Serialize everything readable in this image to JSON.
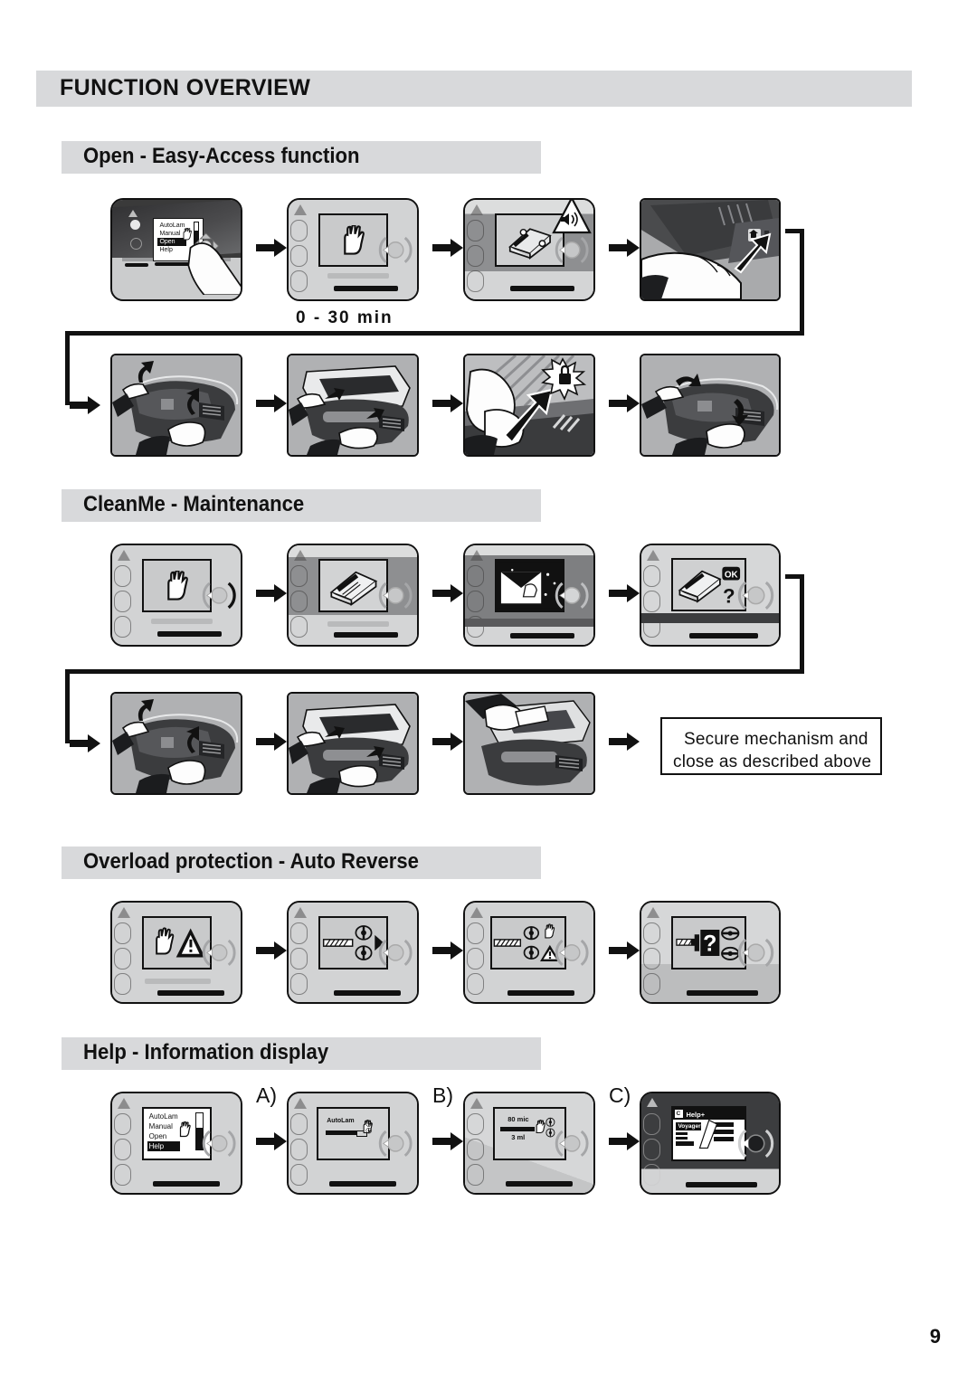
{
  "page": {
    "title": "FUNCTION OVERVIEW",
    "number": "9"
  },
  "sections": [
    {
      "id": "open-easy-access",
      "heading": "Open - Easy-Access function",
      "rows": [
        {
          "steps": [
            {
              "name": "console-menu-select",
              "kind": "device-photo"
            },
            {
              "name": "display-hand-wait",
              "kind": "device-lcd",
              "caption": "0 - 30 min"
            },
            {
              "name": "display-cartridge-beep",
              "kind": "device-lcd"
            },
            {
              "name": "photo-pull-lever",
              "kind": "photo"
            }
          ]
        },
        {
          "steps": [
            {
              "name": "photo-open-lid",
              "kind": "photo"
            },
            {
              "name": "photo-press-rollers",
              "kind": "photo"
            },
            {
              "name": "photo-lock-latch",
              "kind": "photo"
            },
            {
              "name": "photo-close-lid",
              "kind": "photo"
            }
          ]
        }
      ]
    },
    {
      "id": "cleanme-maintenance",
      "heading": "CleanMe - Maintenance",
      "rows": [
        {
          "steps": [
            {
              "name": "display-hand-wait",
              "kind": "device-lcd"
            },
            {
              "name": "display-cleaning-card",
              "kind": "device-lcd"
            },
            {
              "name": "display-insert-sheet",
              "kind": "device-lcd"
            },
            {
              "name": "display-cleaning-ok-question",
              "kind": "device-lcd"
            }
          ]
        },
        {
          "steps": [
            {
              "name": "photo-open-lid",
              "kind": "photo"
            },
            {
              "name": "photo-press-rollers",
              "kind": "photo"
            },
            {
              "name": "photo-wipe-rollers",
              "kind": "photo"
            }
          ],
          "note": {
            "name": "secure-mechanism-note",
            "lines": [
              "Secure mechanism and",
              "close as described above"
            ]
          }
        }
      ]
    },
    {
      "id": "overload-protection",
      "heading": "Overload protection - Auto Reverse",
      "rows": [
        {
          "steps": [
            {
              "name": "display-hand-warning",
              "kind": "device-lcd"
            },
            {
              "name": "display-rollers-forward",
              "kind": "device-lcd"
            },
            {
              "name": "display-rollers-stop-warning",
              "kind": "device-lcd"
            },
            {
              "name": "display-eject-question",
              "kind": "device-lcd"
            }
          ]
        }
      ]
    },
    {
      "id": "help-information-display",
      "heading": "Help - Information display",
      "rows": [
        {
          "steps": [
            {
              "name": "display-main-menu",
              "kind": "device-lcd"
            },
            {
              "name": "display-autolam-setting",
              "kind": "device-lcd",
              "label": "A)"
            },
            {
              "name": "display-thickness-setting",
              "kind": "device-lcd",
              "label": "B)"
            },
            {
              "name": "display-help-plus",
              "kind": "device-lcd",
              "label": "C)"
            }
          ]
        }
      ]
    }
  ],
  "lcd_texts": {
    "main_menu": [
      "AutoLam",
      "Manual",
      "Open",
      "Help"
    ],
    "main_menu_selected": "Help",
    "autolam_label": "AutoLam",
    "thickness_value": "80 mic",
    "volume_value": "3 ml",
    "help_plus_title": "Help+",
    "help_plus_tag": "C",
    "help_plus_body": "Voyager",
    "ok_badge": "OK",
    "question_mark": "?"
  },
  "colors": {
    "bar_grey": "#d8d9db",
    "ink": "#111111",
    "device_face": "#d2d3d4",
    "device_dark": "#3a3a3a",
    "lcd": "#c9cacb",
    "photo_bg": "#a9aaac"
  }
}
